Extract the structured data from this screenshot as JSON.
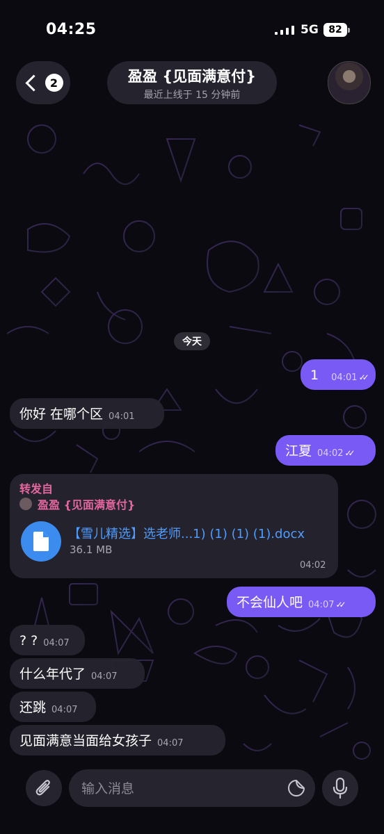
{
  "status_bar": {
    "time": "04:25",
    "network": "5G",
    "battery": "82"
  },
  "header": {
    "back_count": "2",
    "chat_name": "盈盈 {见面满意付}",
    "chat_status": "最近上线于 15 分钟前"
  },
  "date_chip": "今天",
  "messages": [
    {
      "dir": "out",
      "text": "1",
      "time": "04:01"
    },
    {
      "dir": "in",
      "text": "你好 在哪个区",
      "time": "04:01"
    },
    {
      "dir": "out",
      "text": "江夏",
      "time": "04:02"
    },
    {
      "dir": "out",
      "text": "不会仙人吧",
      "time": "04:07"
    },
    {
      "dir": "in",
      "text": "? ?",
      "time": "04:07"
    },
    {
      "dir": "in",
      "text": "什么年代了",
      "time": "04:07"
    },
    {
      "dir": "in",
      "text": "还跳",
      "time": "04:07"
    },
    {
      "dir": "in",
      "text": "见面满意当面给女孩子",
      "time": "04:07"
    }
  ],
  "forwarded": {
    "label": "转发自",
    "from": "盈盈 {见面满意付}",
    "file_name": "【雪儿精选】选老师...1) (1) (1) (1).docx",
    "file_size": "36.1 MB",
    "time": "04:02"
  },
  "composer": {
    "placeholder": "输入消息"
  },
  "colors": {
    "outgoing": "#7a5af5",
    "incoming": "#26242e",
    "file_icon": "#3c8cf0",
    "forward_label": "#e2669f"
  },
  "icons": [
    "back-chevron-icon",
    "paperclip-icon",
    "sticker-icon",
    "microphone-icon",
    "file-icon",
    "double-check-icon"
  ]
}
